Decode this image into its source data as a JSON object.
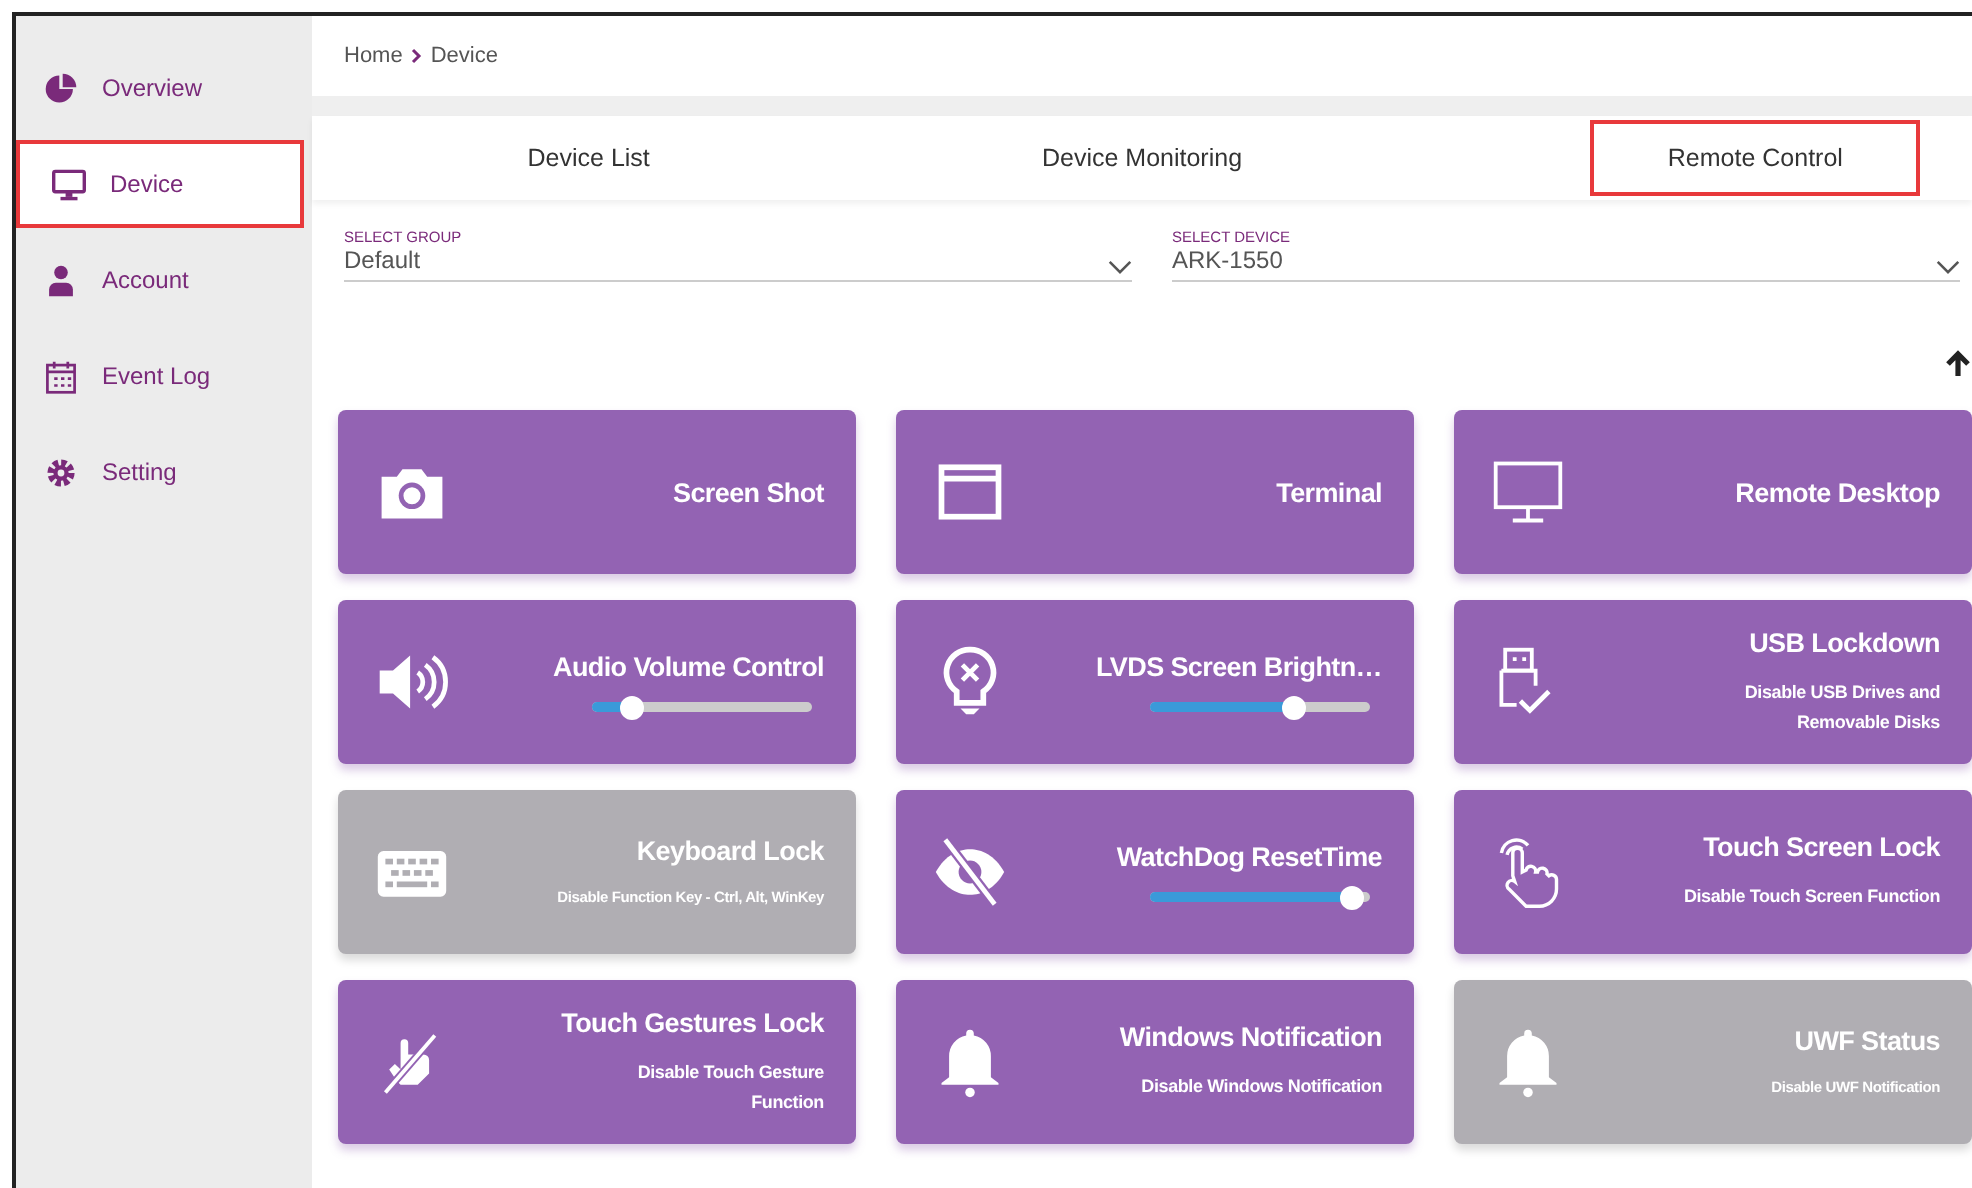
{
  "sidebar": {
    "items": [
      {
        "label": "Overview",
        "selected": false
      },
      {
        "label": "Device",
        "selected": true
      },
      {
        "label": "Account",
        "selected": false
      },
      {
        "label": "Event Log",
        "selected": false
      },
      {
        "label": "Setting",
        "selected": false
      }
    ]
  },
  "breadcrumb": [
    "Home",
    "Device"
  ],
  "tabs": [
    {
      "label": "Device List",
      "selected": false
    },
    {
      "label": "Device Monitoring",
      "selected": false
    },
    {
      "label": "Remote Control",
      "selected": true
    }
  ],
  "selects": [
    {
      "label": "SELECT GROUP",
      "value": "Default"
    },
    {
      "label": "SELECT DEVICE",
      "value": "ARK-1550"
    }
  ],
  "cards": [
    {
      "kind": "plain",
      "title": "Screen Shot",
      "enabled": true
    },
    {
      "kind": "plain",
      "title": "Terminal",
      "enabled": true
    },
    {
      "kind": "plain",
      "title": "Remote Desktop",
      "enabled": true
    },
    {
      "kind": "slider",
      "title": "Audio Volume Control",
      "enabled": true,
      "level": 0.18
    },
    {
      "kind": "slider",
      "title": "LVDS Screen Brightn…",
      "enabled": true,
      "level": 0.65
    },
    {
      "kind": "desc",
      "title": "USB Lockdown",
      "enabled": true,
      "description": "Disable USB Drives and Removable Disks"
    },
    {
      "kind": "desc",
      "title": "Keyboard Lock",
      "enabled": false,
      "description": "Disable Function Key - Ctrl, Alt, WinKey"
    },
    {
      "kind": "slider",
      "title": "WatchDog ResetTime",
      "enabled": true,
      "level": 0.92
    },
    {
      "kind": "desc",
      "title": "Touch Screen Lock",
      "enabled": true,
      "description": "Disable Touch Screen Function"
    },
    {
      "kind": "desc",
      "title": "Touch Gestures Lock",
      "enabled": true,
      "description": "Disable Touch Gesture Function"
    },
    {
      "kind": "desc",
      "title": "Windows Notification",
      "enabled": true,
      "description": "Disable Windows Notification"
    },
    {
      "kind": "desc",
      "title": "UWF Status",
      "enabled": false,
      "description": "Disable UWF Notification"
    }
  ]
}
